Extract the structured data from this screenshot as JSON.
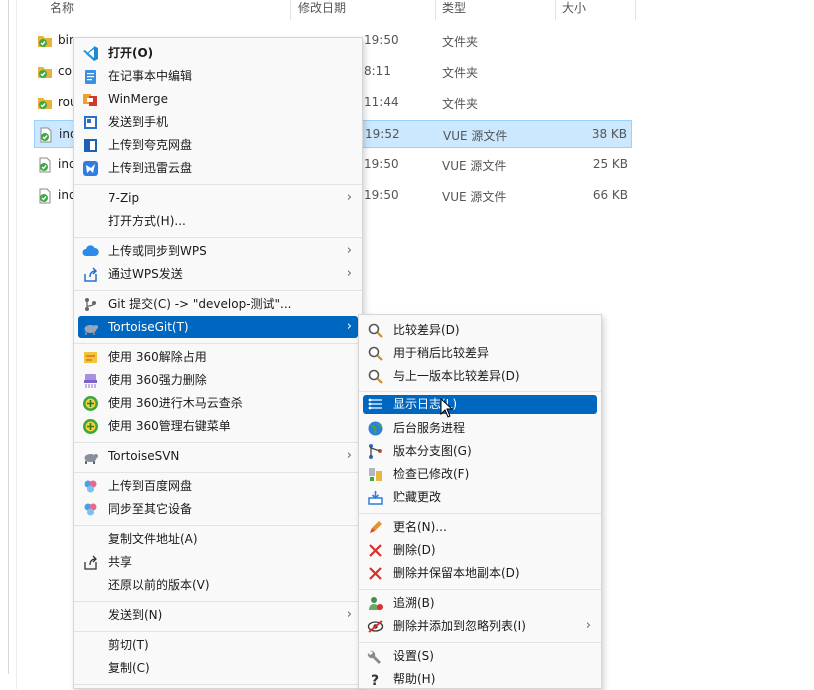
{
  "columns": {
    "name": "名称",
    "date": "修改日期",
    "type": "类型",
    "size": "大小"
  },
  "files": [
    {
      "name": "bin",
      "date": "",
      "type": "文件夹",
      "size": ""
    },
    {
      "name": "co",
      "date": "8:11",
      "type": "文件夹",
      "size": ""
    },
    {
      "name": "rou",
      "date": "11:44",
      "type": "文件夹",
      "size": ""
    },
    {
      "name": "ind",
      "date": "19:52",
      "type": "VUE 源文件",
      "size": "38 KB"
    },
    {
      "name": "ind",
      "date": "19:50",
      "type": "VUE 源文件",
      "size": "25 KB"
    },
    {
      "name": "ind",
      "date": "19:50",
      "type": "VUE 源文件",
      "size": "66 KB"
    }
  ],
  "file_top_date": "19:50",
  "main_menu": {
    "items": [
      {
        "label": "打开(O)",
        "icon": "vscode-icon"
      },
      {
        "label": "在记事本中编辑",
        "icon": "notepad-icon"
      },
      {
        "label": "WinMerge",
        "icon": "winmerge-icon"
      },
      {
        "label": "发送到手机",
        "icon": "phone-icon"
      },
      {
        "label": "上传到夸克网盘",
        "icon": "quark-icon"
      },
      {
        "label": "上传到迅雷云盘",
        "icon": "xunlei-icon"
      },
      {
        "label": "7-Zip",
        "icon": ""
      },
      {
        "label": "打开方式(H)...",
        "icon": ""
      },
      {
        "label": "上传或同步到WPS",
        "icon": "wps-cloud-icon"
      },
      {
        "label": "通过WPS发送",
        "icon": "share-icon"
      },
      {
        "label": "Git 提交(C) -> \"develop-测试\"...",
        "icon": "git-commit-icon"
      },
      {
        "label": "TortoiseGit(T)",
        "icon": "tortoisegit-icon"
      },
      {
        "label": "使用 360解除占用",
        "icon": "unlock-icon"
      },
      {
        "label": "使用 360强力删除",
        "icon": "shred-icon"
      },
      {
        "label": "使用 360进行木马云查杀",
        "icon": "scan-icon"
      },
      {
        "label": "使用 360管理右键菜单",
        "icon": "manage-icon"
      },
      {
        "label": "TortoiseSVN",
        "icon": "tortoisesvn-icon"
      },
      {
        "label": "上传到百度网盘",
        "icon": "baidu-icon"
      },
      {
        "label": "同步至其它设备",
        "icon": "baidu-sync-icon"
      },
      {
        "label": "复制文件地址(A)",
        "icon": ""
      },
      {
        "label": "共享",
        "icon": "share-icon"
      },
      {
        "label": "还原以前的版本(V)",
        "icon": ""
      },
      {
        "label": "发送到(N)",
        "icon": ""
      },
      {
        "label": "剪切(T)",
        "icon": ""
      },
      {
        "label": "复制(C)",
        "icon": ""
      }
    ]
  },
  "sub_menu": {
    "items": [
      {
        "label": "比较差异(D)"
      },
      {
        "label": "用于稍后比较差异"
      },
      {
        "label": "与上一版本比较差异(D)"
      },
      {
        "label": "显示日志(L)"
      },
      {
        "label": "后台服务进程"
      },
      {
        "label": "版本分支图(G)"
      },
      {
        "label": "检查已修改(F)"
      },
      {
        "label": "贮藏更改"
      },
      {
        "label": "更名(N)..."
      },
      {
        "label": "删除(D)"
      },
      {
        "label": "删除并保留本地副本(D)"
      },
      {
        "label": "追溯(B)"
      },
      {
        "label": "删除并添加到忽略列表(I)"
      },
      {
        "label": "设置(S)"
      },
      {
        "label": "帮助(H)"
      }
    ]
  },
  "colors": {
    "highlight": "#0067c0",
    "selected_row": "#cce8ff",
    "folder": "#e8b33a",
    "git_green": "#3ea843"
  }
}
